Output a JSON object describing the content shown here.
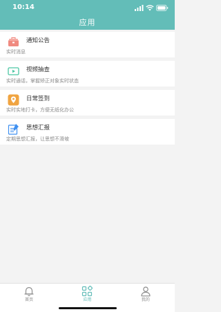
{
  "status_bar": {
    "time": "10:14",
    "icons": [
      "signal-icon",
      "wifi-icon",
      "battery-icon"
    ]
  },
  "header": {
    "title": "应用"
  },
  "cards": [
    {
      "icon": "notice-bag-icon",
      "title": "通知公告",
      "desc": "实时消息",
      "icon_color": "#f08a80"
    },
    {
      "icon": "video-camera-icon",
      "title": "视频抽查",
      "desc": "实时通话，掌握矫正对象实时状态",
      "icon_color": "#4cc7a3"
    },
    {
      "icon": "location-pin-icon",
      "title": "日常签到",
      "desc": "实时实地打卡，方便无纸化办公",
      "icon_color": "#f0a441"
    },
    {
      "icon": "report-edit-icon",
      "title": "思想汇报",
      "desc": "定期思想汇报，让思想不滑坡",
      "icon_color": "#3d8ff0"
    }
  ],
  "tabs": [
    {
      "label": "首页",
      "icon": "bell-icon",
      "active": false
    },
    {
      "label": "应用",
      "icon": "apps-grid-icon",
      "active": true
    },
    {
      "label": "我的",
      "icon": "person-icon",
      "active": false
    }
  ],
  "colors": {
    "primary": "#63bdb8",
    "background": "#f3f3f3",
    "inactive_tab": "#8c8c8c"
  }
}
